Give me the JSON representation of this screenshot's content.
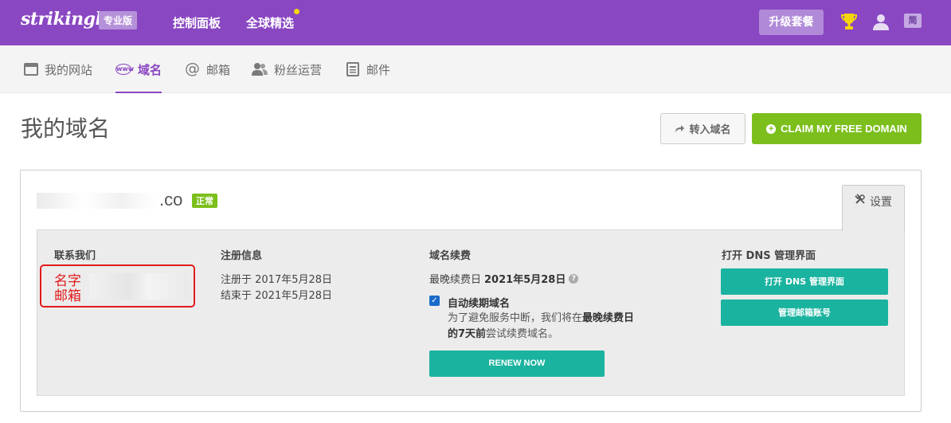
{
  "topbar": {
    "logo": "strikingly",
    "plan_badge": "专业版",
    "nav_dashboard": "控制面板",
    "nav_global": "全球精选",
    "upgrade_label": "升级套餐",
    "lang_badge": "简"
  },
  "subnav": {
    "items": [
      {
        "label": "我的网站",
        "icon": "browser-window-icon"
      },
      {
        "label": "域名",
        "icon": "www-globe-icon",
        "active": true
      },
      {
        "label": "邮箱",
        "icon": "at-icon"
      },
      {
        "label": "粉丝运营",
        "icon": "users-icon"
      },
      {
        "label": "邮件",
        "icon": "newsletter-icon"
      }
    ]
  },
  "page": {
    "title": "我的域名",
    "transfer_label": "转入域名",
    "claim_label": "CLAIM MY FREE DOMAIN"
  },
  "domain": {
    "name_visible": ".co",
    "status": "正常",
    "settings_label": "设置",
    "contact": {
      "title": "联系我们",
      "name_label": "名字",
      "email_label": "邮箱"
    },
    "registration": {
      "title": "注册信息",
      "registered": "注册于 2017年5月28日",
      "expires": "结束于 2021年5月28日"
    },
    "renewal": {
      "title": "域名续费",
      "deadline_prefix": "最晚续费日",
      "deadline_date": "2021年5月28日",
      "auto_renew_label": "自动续期域名",
      "auto_renew_checked": true,
      "auto_desc_prefix": "为了避免服务中断，我们将在",
      "auto_desc_bold": "最晚续费日的7天前",
      "auto_desc_suffix": "尝试续费域名。",
      "renew_button": "RENEW NOW"
    },
    "dns": {
      "title": "打开 DNS 管理界面",
      "open_button": "打开 DNS 管理界面",
      "mail_button": "管理邮箱账号"
    }
  },
  "colors": {
    "brand_purple": "#8a47c2",
    "green": "#7cbf1c",
    "teal": "#1ab39f",
    "annotation_red": "#e21a1a"
  }
}
